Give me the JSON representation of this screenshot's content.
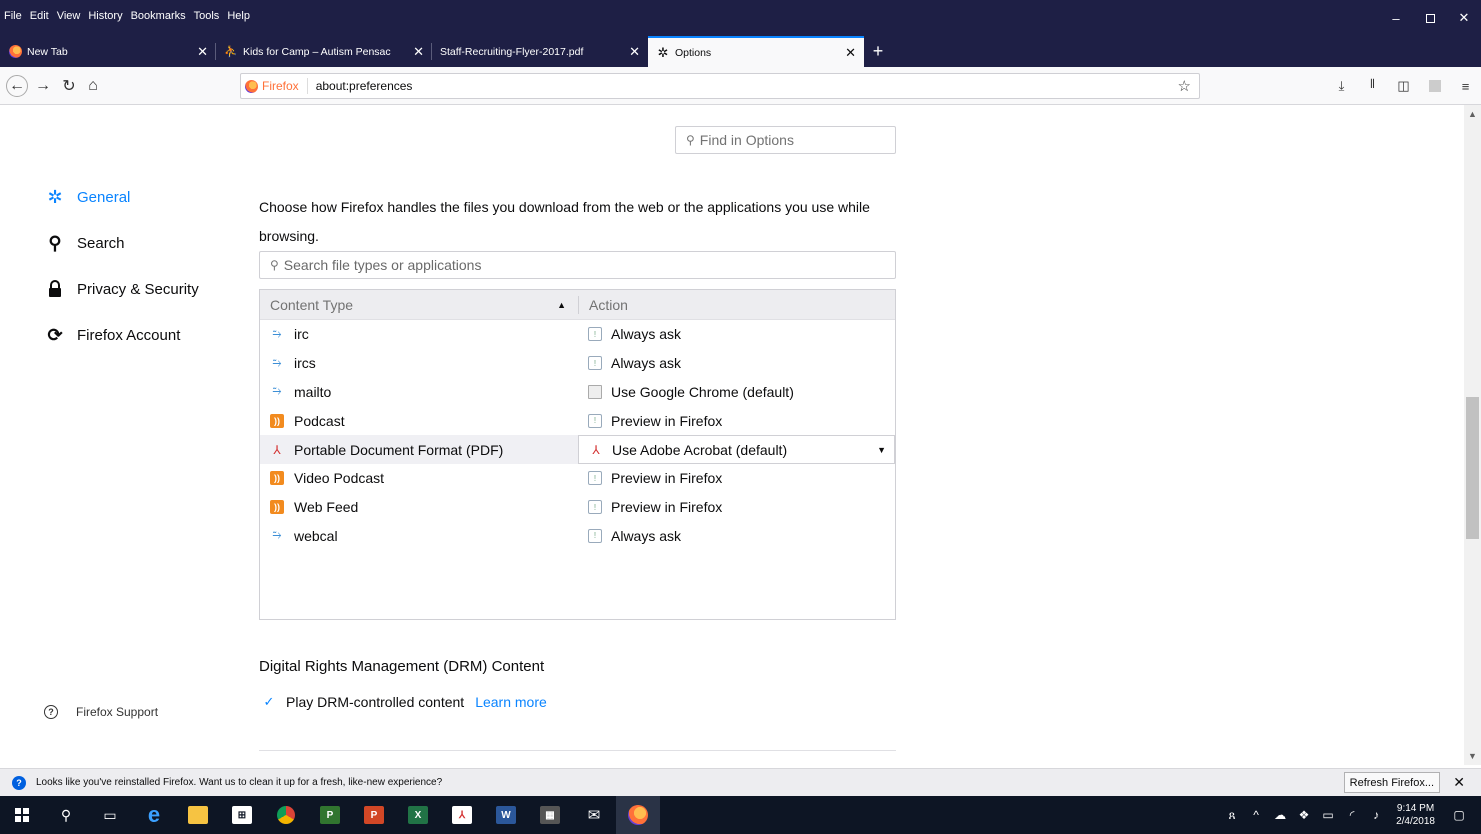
{
  "menubar": [
    "File",
    "Edit",
    "View",
    "History",
    "Bookmarks",
    "Tools",
    "Help"
  ],
  "window_controls": {
    "minimize": "–",
    "restore": "ⓓ",
    "close": "✕"
  },
  "tabs": [
    {
      "title": "New Tab",
      "close": "✕"
    },
    {
      "title": "Kids for Camp – Autism Pensac",
      "close": "✕"
    },
    {
      "title": "Staff-Recruiting-Flyer-2017.pdf",
      "close": "✕"
    },
    {
      "title": "Options",
      "close": "✕"
    }
  ],
  "new_tab": "+",
  "urlbar": {
    "identity": "Firefox",
    "url": "about:preferences"
  },
  "find": {
    "placeholder": "Find in Options"
  },
  "categories": [
    {
      "label": "General",
      "icon": "gear-icon"
    },
    {
      "label": "Search",
      "icon": "search-icon"
    },
    {
      "label": "Privacy & Security",
      "icon": "lock-icon"
    },
    {
      "label": "Firefox Account",
      "icon": "sync-icon"
    }
  ],
  "support": "Firefox Support",
  "applications": {
    "description": "Choose how Firefox handles the files you download from the web or the applications you use while browsing.",
    "search_placeholder": "Search file types or applications",
    "headers": {
      "content_type": "Content Type",
      "action": "Action"
    },
    "rows": [
      {
        "type": "irc",
        "action": "Always ask"
      },
      {
        "type": "ircs",
        "action": "Always ask"
      },
      {
        "type": "mailto",
        "action": "Use Google Chrome (default)"
      },
      {
        "type": "Podcast",
        "action": "Preview in Firefox"
      },
      {
        "type": "Portable Document Format (PDF)",
        "action": "Use Adobe Acrobat  (default)"
      },
      {
        "type": "Video Podcast",
        "action": "Preview in Firefox"
      },
      {
        "type": "Web Feed",
        "action": "Preview in Firefox"
      },
      {
        "type": "webcal",
        "action": "Always ask"
      }
    ]
  },
  "drm": {
    "title": "Digital Rights Management (DRM) Content",
    "checkbox_label": "Play DRM-controlled content",
    "learn_more": "Learn more",
    "checked": true
  },
  "notification": {
    "text": "Looks like you've reinstalled Firefox. Want us to clean it up for a fresh, like-new experience?",
    "button": "Refresh Firefox...",
    "close": "✕"
  },
  "taskbar": {
    "time": "9:14 PM",
    "date": "2/4/2018"
  },
  "colors": {
    "accent": "#0a84ff",
    "chrome_dark": "#1e1f45",
    "taskbar": "#0d1524"
  }
}
